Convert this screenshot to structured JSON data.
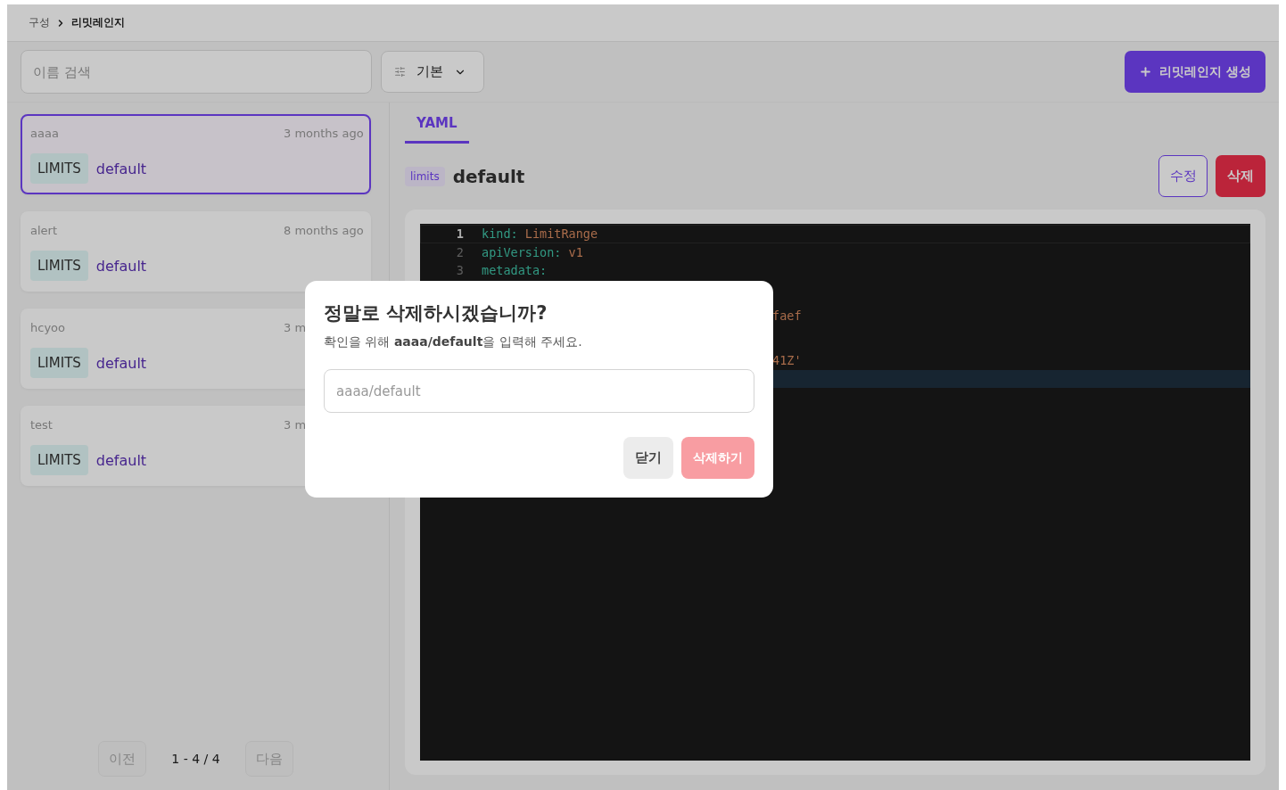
{
  "breadcrumb": [
    {
      "label": "구성",
      "current": false
    },
    {
      "label": "리밋레인지",
      "current": true
    }
  ],
  "toolbar": {
    "search": {
      "placeholder": "이름 검색"
    },
    "filter": {
      "label": "기본"
    },
    "create_button": {
      "label": "리밋레인지 생성"
    }
  },
  "items": [
    {
      "name": "aaaa",
      "time": "3 months ago",
      "badge": "LIMITS",
      "label": "default",
      "selected": true
    },
    {
      "name": "alert",
      "time": "8 months ago",
      "badge": "LIMITS",
      "label": "default",
      "selected": false
    },
    {
      "name": "hcyoo",
      "time": "3 m",
      "badge": "LIMITS",
      "label": "default",
      "selected": false
    },
    {
      "name": "test",
      "time": "3 m",
      "badge": "LIMITS",
      "label": "default",
      "selected": false
    }
  ],
  "pagination": {
    "prev": {
      "label": "이전",
      "disabled": true
    },
    "range": "1 - 4 / 4",
    "next": {
      "label": "다음",
      "disabled": true
    }
  },
  "detail": {
    "tabs": [
      {
        "label": "YAML",
        "selected": true
      }
    ],
    "badge": "limits",
    "title": "default",
    "edit_button": "수정",
    "delete_button": "삭제",
    "code": [
      {
        "kind": "full",
        "number": "1",
        "key": "kind:",
        "value": "LimitRange",
        "active": true
      },
      {
        "kind": "full",
        "number": "2",
        "key": "apiVersion:",
        "value": "v1",
        "active": false
      },
      {
        "kind": "full",
        "number": "3",
        "key": "metadata:",
        "active": false
      },
      {
        "kind": "partial",
        "text": "faef",
        "active": false
      },
      {
        "kind": "partial",
        "text": "41Z'",
        "active": false
      },
      {
        "kind": "cursor",
        "active": false
      }
    ]
  },
  "modal": {
    "title": "정말로 삭제하시겠습니까?",
    "message": "확인을 위해 **aaaa/default**을 입력해 주세요.",
    "placeholder": "aaaa/default",
    "close_button": "닫기",
    "confirm_button": {
      "label": "삭제하기",
      "disabled": true
    }
  }
}
